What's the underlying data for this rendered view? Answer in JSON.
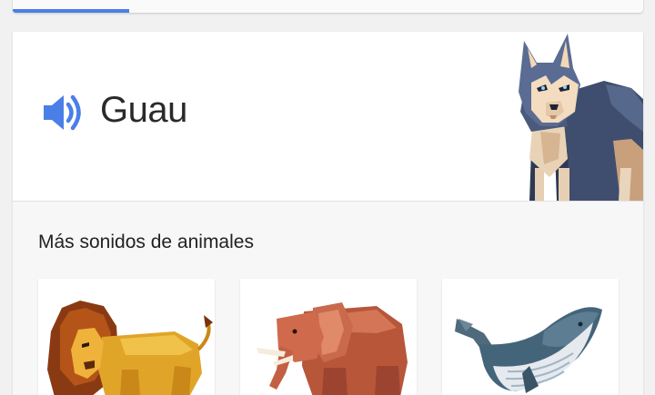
{
  "header": {
    "active_tab_color": "#4a7fe8"
  },
  "result": {
    "speaker_icon": "volume-icon",
    "speaker_color": "#4a7fe8",
    "word": "Guau",
    "image": "dog-illustration"
  },
  "more": {
    "title": "Más sonidos de animales",
    "tiles": [
      {
        "image": "lion-illustration"
      },
      {
        "image": "elephant-illustration"
      },
      {
        "image": "whale-illustration"
      }
    ]
  }
}
